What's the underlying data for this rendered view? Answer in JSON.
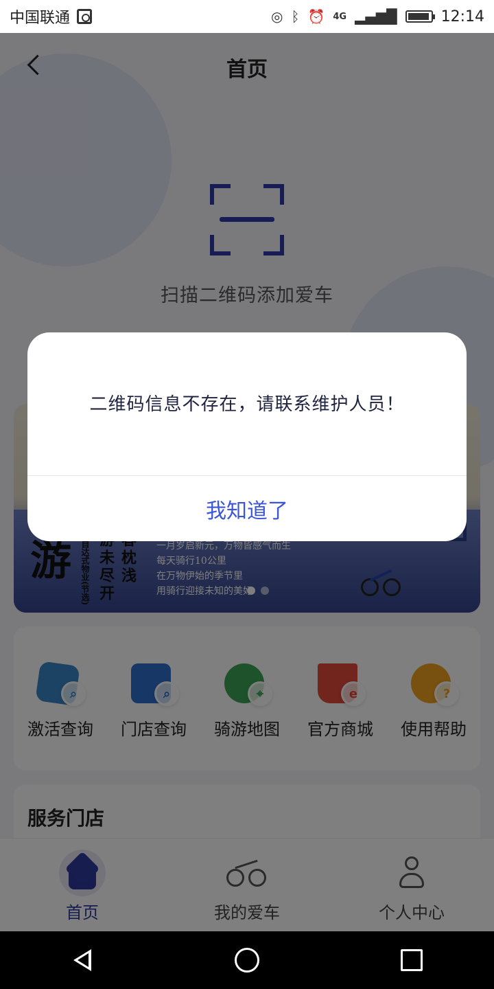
{
  "status_bar": {
    "carrier": "中国联通",
    "time": "12:14",
    "icons": [
      "hotspot-icon",
      "bluetooth-icon",
      "alarm-icon",
      "4g-signal-icon",
      "battery-icon"
    ],
    "network_label": "4G"
  },
  "header": {
    "title": "首页"
  },
  "scan": {
    "label": "扫描二维码添加爱车"
  },
  "banner": {
    "calligraphy": "游",
    "poem_small": "京自达式物业(节选)",
    "poem_col1": "游未尽开",
    "poem_col2": "春枕浅",
    "lines": [
      "一月岁启新元，万物皆感气而生",
      "每天骑行10公里",
      "在万物伊始的季节里",
      "用骑行迎接未知的美好"
    ],
    "page_count": 2,
    "active_page": 1
  },
  "quick_actions": [
    {
      "label": "激活查询",
      "icon": "activation-query-icon",
      "color": "#3a86c8",
      "glass": "⌕"
    },
    {
      "label": "门店查询",
      "icon": "store-query-icon",
      "color": "#2f6fcf",
      "glass": "⌕"
    },
    {
      "label": "骑游地图",
      "icon": "cycling-map-icon",
      "color": "#3aa454",
      "glass": "⌖"
    },
    {
      "label": "官方商城",
      "icon": "official-mall-icon",
      "color": "#e24a3b",
      "glass": "e"
    },
    {
      "label": "使用帮助",
      "icon": "help-icon",
      "color": "#f0a020",
      "glass": "?"
    }
  ],
  "stores": {
    "title": "服务门店"
  },
  "tabs": [
    {
      "label": "首页",
      "icon": "home-icon",
      "active": true
    },
    {
      "label": "我的爱车",
      "icon": "bicycle-icon",
      "active": false
    },
    {
      "label": "个人中心",
      "icon": "person-icon",
      "active": false
    }
  ],
  "dialog": {
    "message": "二维码信息不存在，请联系维护人员！",
    "button": "我知道了"
  },
  "colors": {
    "accent": "#3b55d9",
    "brand_dark": "#2e3a9e",
    "overlay": "rgba(0,0,0,0.5)"
  }
}
